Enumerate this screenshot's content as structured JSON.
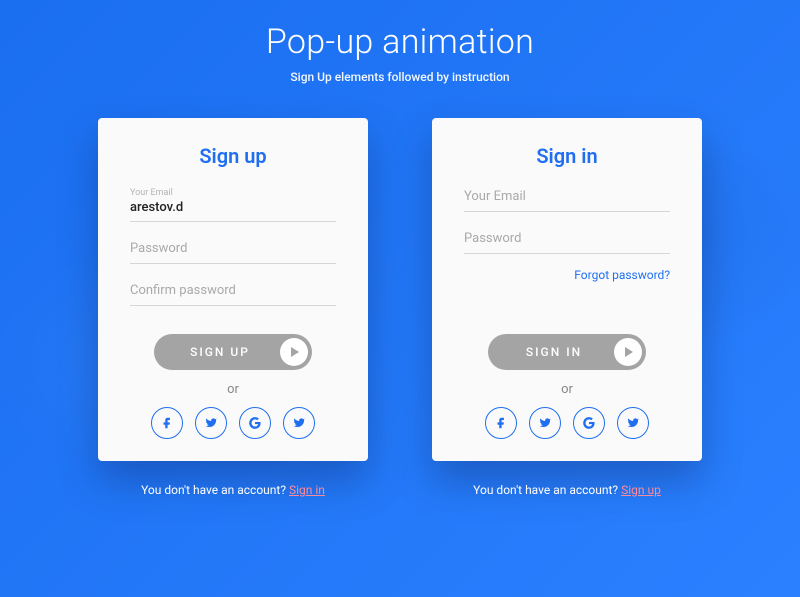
{
  "header": {
    "title": "Pop-up animation",
    "subtitle": "Sign Up elements followed by instruction"
  },
  "common": {
    "or": "or",
    "footer_prefix": "You don't have an account? "
  },
  "signup": {
    "title": "Sign up",
    "email_label": "Your Email",
    "email_value": "arestov.d",
    "password_placeholder": "Password",
    "confirm_placeholder": "Confirm password",
    "cta": "SIGN UP",
    "footer_link": "Sign in"
  },
  "signin": {
    "title": "Sign in",
    "email_placeholder": "Your Email",
    "password_placeholder": "Password",
    "forgot": "Forgot password?",
    "cta": "SIGN IN",
    "footer_link": "Sign up"
  },
  "social": {
    "items": [
      "facebook",
      "twitter",
      "google",
      "twitter"
    ]
  }
}
